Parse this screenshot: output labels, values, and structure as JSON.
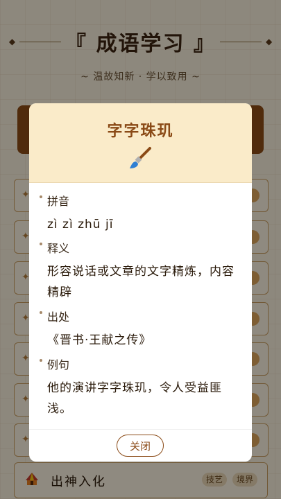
{
  "header": {
    "title": "『 成语学习 』",
    "subtitle": "~ 温故知新 · 学以致用 ~"
  },
  "bottom_item": {
    "name": "出神入化",
    "tags": [
      "技艺",
      "境界"
    ]
  },
  "modal": {
    "title": "字字珠玑",
    "icon": "paintbrush-icon",
    "sections": [
      {
        "label": "拼音",
        "text": "zì zì zhū jī"
      },
      {
        "label": "释义",
        "text": "形容说话或文章的文字精炼，内容精辟"
      },
      {
        "label": "出处",
        "text": "《晋书·王献之传》"
      },
      {
        "label": "例句",
        "text": "他的演讲字字珠玑，令人受益匪浅。"
      }
    ],
    "close_label": "关闭"
  },
  "colors": {
    "accent": "#8a4a16",
    "header_bg": "#faebc9",
    "page_bg": "#f3ead8"
  }
}
